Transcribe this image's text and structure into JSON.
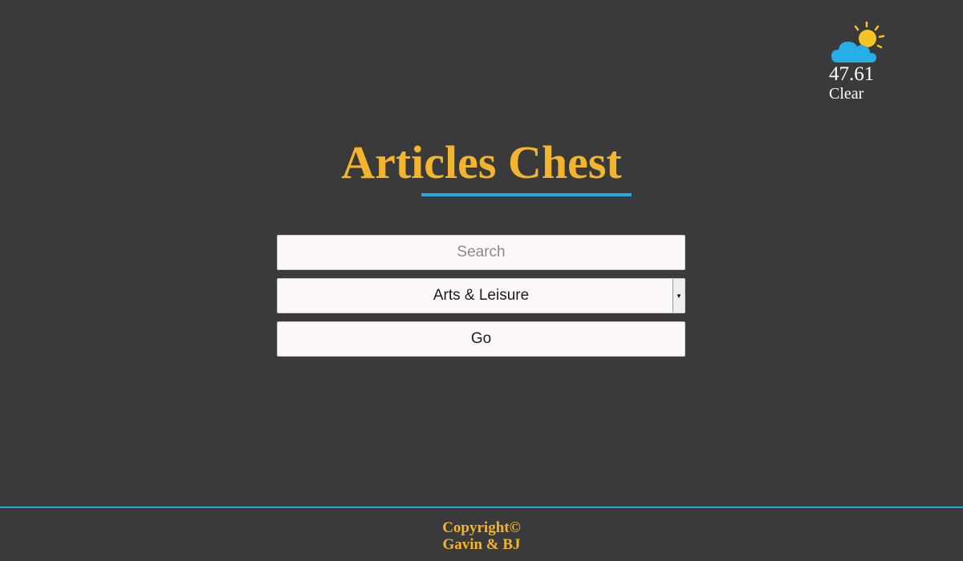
{
  "weather": {
    "icon": "partly-sunny-icon",
    "temperature": "47.61",
    "condition": "Clear",
    "colors": {
      "sun": "#f7c325",
      "cloud": "#27aee6"
    }
  },
  "header": {
    "title": "Articles Chest"
  },
  "form": {
    "search_placeholder": "Search",
    "search_value": "",
    "category_selected": "Arts & Leisure",
    "go_label": "Go"
  },
  "footer": {
    "line1": "Copyright©",
    "line2": "Gavin & BJ"
  },
  "colors": {
    "background": "#3a3a3a",
    "accent_gold": "#f4b52e",
    "accent_blue": "#1aaee5"
  }
}
